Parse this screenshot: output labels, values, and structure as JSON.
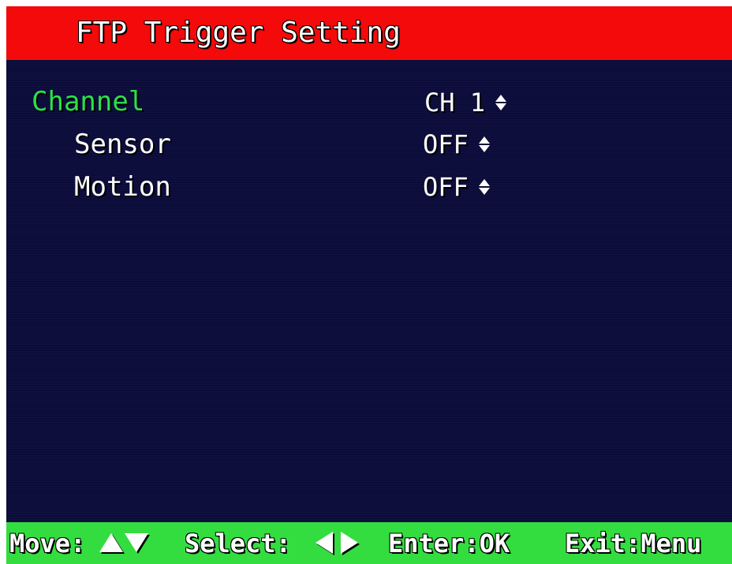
{
  "header": {
    "title": "FTP Trigger Setting"
  },
  "menu": {
    "items": [
      {
        "label": "Channel",
        "value": "CH 1",
        "selected": true
      },
      {
        "label": "Sensor",
        "value": "OFF",
        "selected": false
      },
      {
        "label": "Motion",
        "value": "OFF",
        "selected": false
      }
    ]
  },
  "footer": {
    "move_label": "Move:",
    "select_label": "Select:",
    "enter_label": "Enter:OK",
    "exit_label": "Exit:Menu"
  },
  "colors": {
    "title_bar": "#f40a0a",
    "panel": "#0b0c3a",
    "footer_bar": "#33dd3f",
    "selected_text": "#2ee04a",
    "normal_text": "#ffffff"
  },
  "icons": {
    "value_adjust": "up-down-arrows-icon",
    "move": "up-down-triangle-icon",
    "select": "left-right-triangle-icon"
  }
}
